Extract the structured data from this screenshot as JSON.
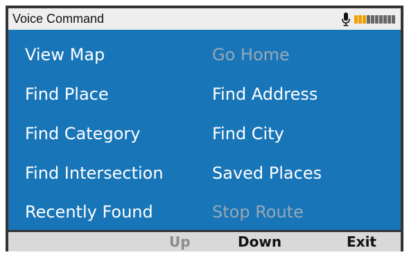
{
  "header": {
    "title": "Voice Command",
    "mic_icon": "microphone-icon",
    "volume_level": 0.3,
    "volume_segments_total": 10,
    "volume_segments_lit": 3,
    "meter_active_color": "#f0a000"
  },
  "menu": {
    "left": [
      {
        "label": "View Map",
        "enabled": true
      },
      {
        "label": "Find Place",
        "enabled": true
      },
      {
        "label": "Find Category",
        "enabled": true
      },
      {
        "label": "Find Intersection",
        "enabled": true
      },
      {
        "label": "Recently Found",
        "enabled": true
      }
    ],
    "right": [
      {
        "label": "Go Home",
        "enabled": false
      },
      {
        "label": "Find Address",
        "enabled": true
      },
      {
        "label": "Find City",
        "enabled": true
      },
      {
        "label": "Saved Places",
        "enabled": true
      },
      {
        "label": "Stop Route",
        "enabled": false
      }
    ]
  },
  "softkeys": {
    "up": {
      "label": "Up",
      "enabled": false
    },
    "down": {
      "label": "Down",
      "enabled": true
    },
    "exit": {
      "label": "Exit",
      "enabled": true
    }
  },
  "colors": {
    "menu_background": "#1875b8",
    "enabled_text": "#ffffff",
    "disabled_text": "#98a8b6"
  }
}
